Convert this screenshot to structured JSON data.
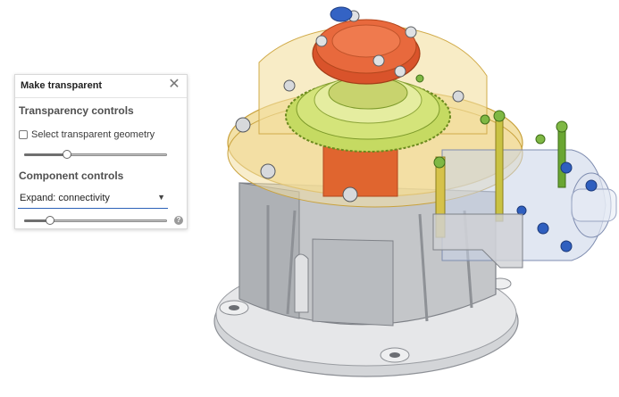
{
  "panel": {
    "title": "Make transparent",
    "close_icon": "close-icon",
    "transparency": {
      "section_title": "Transparency controls",
      "checkbox_label": "Select transparent geometry",
      "checkbox_checked": false,
      "slider_level": 0.3
    },
    "component": {
      "section_title": "Component controls",
      "dropdown_value": "Expand: connectivity",
      "slider_level": 0.18,
      "help_icon": "help-icon"
    }
  },
  "colors": {
    "accent": "#2c62b8",
    "housing_gray": "#c4c6c9",
    "transparent_flange": "#e9c45a",
    "gear_green": "#b9d24a",
    "cap_orange": "#e0653a",
    "bolt_blue": "#2f5fbf",
    "stud_green": "#6aa632"
  }
}
